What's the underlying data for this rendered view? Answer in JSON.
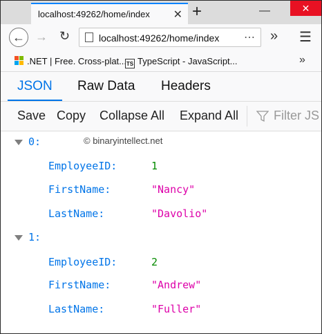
{
  "browser": {
    "tab_title": "localhost:49262/home/index",
    "url": "localhost:49262/home/index",
    "close_glyph": "✕",
    "new_tab_glyph": "+",
    "minimize_glyph": "—",
    "window_close_glyph": "✕",
    "more_glyph": "»",
    "menu_glyph": "☰"
  },
  "bookmarks": [
    {
      "label": ".NET | Free. Cross-plat...",
      "icon": "microsoft-logo-icon"
    },
    {
      "label": "TypeScript - JavaScript...",
      "icon": "typescript-logo-icon",
      "icon_text": "TS"
    }
  ],
  "viewer": {
    "tabs": [
      "JSON",
      "Raw Data",
      "Headers"
    ],
    "active_tab": "JSON",
    "toolbar": {
      "save": "Save",
      "copy": "Copy",
      "collapse_all": "Collapse All",
      "expand_all": "Expand All",
      "filter_placeholder": "Filter JS"
    }
  },
  "watermark": "© binaryintellect.net",
  "records": [
    {
      "index": "0:",
      "fields": [
        {
          "key": "EmployeeID:",
          "value": "1",
          "type": "number"
        },
        {
          "key": "FirstName:",
          "value": "\"Nancy\"",
          "type": "string"
        },
        {
          "key": "LastName:",
          "value": "\"Davolio\"",
          "type": "string"
        }
      ]
    },
    {
      "index": "1:",
      "fields": [
        {
          "key": "EmployeeID:",
          "value": "2",
          "type": "number"
        },
        {
          "key": "FirstName:",
          "value": "\"Andrew\"",
          "type": "string"
        },
        {
          "key": "LastName:",
          "value": "\"Fuller\"",
          "type": "string"
        }
      ]
    }
  ],
  "colors": {
    "accent": "#0074e8",
    "key": "#0074e8",
    "number": "#058b00",
    "string": "#dd00a9"
  }
}
